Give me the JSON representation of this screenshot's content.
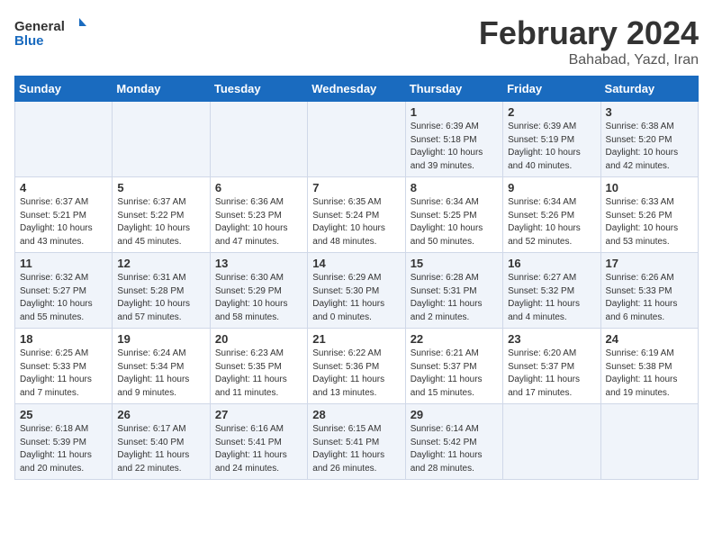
{
  "logo": {
    "line1": "General",
    "line2": "Blue"
  },
  "title": "February 2024",
  "subtitle": "Bahabad, Yazd, Iran",
  "weekdays": [
    "Sunday",
    "Monday",
    "Tuesday",
    "Wednesday",
    "Thursday",
    "Friday",
    "Saturday"
  ],
  "weeks": [
    [
      {
        "day": "",
        "info": ""
      },
      {
        "day": "",
        "info": ""
      },
      {
        "day": "",
        "info": ""
      },
      {
        "day": "",
        "info": ""
      },
      {
        "day": "1",
        "info": "Sunrise: 6:39 AM\nSunset: 5:18 PM\nDaylight: 10 hours\nand 39 minutes."
      },
      {
        "day": "2",
        "info": "Sunrise: 6:39 AM\nSunset: 5:19 PM\nDaylight: 10 hours\nand 40 minutes."
      },
      {
        "day": "3",
        "info": "Sunrise: 6:38 AM\nSunset: 5:20 PM\nDaylight: 10 hours\nand 42 minutes."
      }
    ],
    [
      {
        "day": "4",
        "info": "Sunrise: 6:37 AM\nSunset: 5:21 PM\nDaylight: 10 hours\nand 43 minutes."
      },
      {
        "day": "5",
        "info": "Sunrise: 6:37 AM\nSunset: 5:22 PM\nDaylight: 10 hours\nand 45 minutes."
      },
      {
        "day": "6",
        "info": "Sunrise: 6:36 AM\nSunset: 5:23 PM\nDaylight: 10 hours\nand 47 minutes."
      },
      {
        "day": "7",
        "info": "Sunrise: 6:35 AM\nSunset: 5:24 PM\nDaylight: 10 hours\nand 48 minutes."
      },
      {
        "day": "8",
        "info": "Sunrise: 6:34 AM\nSunset: 5:25 PM\nDaylight: 10 hours\nand 50 minutes."
      },
      {
        "day": "9",
        "info": "Sunrise: 6:34 AM\nSunset: 5:26 PM\nDaylight: 10 hours\nand 52 minutes."
      },
      {
        "day": "10",
        "info": "Sunrise: 6:33 AM\nSunset: 5:26 PM\nDaylight: 10 hours\nand 53 minutes."
      }
    ],
    [
      {
        "day": "11",
        "info": "Sunrise: 6:32 AM\nSunset: 5:27 PM\nDaylight: 10 hours\nand 55 minutes."
      },
      {
        "day": "12",
        "info": "Sunrise: 6:31 AM\nSunset: 5:28 PM\nDaylight: 10 hours\nand 57 minutes."
      },
      {
        "day": "13",
        "info": "Sunrise: 6:30 AM\nSunset: 5:29 PM\nDaylight: 10 hours\nand 58 minutes."
      },
      {
        "day": "14",
        "info": "Sunrise: 6:29 AM\nSunset: 5:30 PM\nDaylight: 11 hours\nand 0 minutes."
      },
      {
        "day": "15",
        "info": "Sunrise: 6:28 AM\nSunset: 5:31 PM\nDaylight: 11 hours\nand 2 minutes."
      },
      {
        "day": "16",
        "info": "Sunrise: 6:27 AM\nSunset: 5:32 PM\nDaylight: 11 hours\nand 4 minutes."
      },
      {
        "day": "17",
        "info": "Sunrise: 6:26 AM\nSunset: 5:33 PM\nDaylight: 11 hours\nand 6 minutes."
      }
    ],
    [
      {
        "day": "18",
        "info": "Sunrise: 6:25 AM\nSunset: 5:33 PM\nDaylight: 11 hours\nand 7 minutes."
      },
      {
        "day": "19",
        "info": "Sunrise: 6:24 AM\nSunset: 5:34 PM\nDaylight: 11 hours\nand 9 minutes."
      },
      {
        "day": "20",
        "info": "Sunrise: 6:23 AM\nSunset: 5:35 PM\nDaylight: 11 hours\nand 11 minutes."
      },
      {
        "day": "21",
        "info": "Sunrise: 6:22 AM\nSunset: 5:36 PM\nDaylight: 11 hours\nand 13 minutes."
      },
      {
        "day": "22",
        "info": "Sunrise: 6:21 AM\nSunset: 5:37 PM\nDaylight: 11 hours\nand 15 minutes."
      },
      {
        "day": "23",
        "info": "Sunrise: 6:20 AM\nSunset: 5:37 PM\nDaylight: 11 hours\nand 17 minutes."
      },
      {
        "day": "24",
        "info": "Sunrise: 6:19 AM\nSunset: 5:38 PM\nDaylight: 11 hours\nand 19 minutes."
      }
    ],
    [
      {
        "day": "25",
        "info": "Sunrise: 6:18 AM\nSunset: 5:39 PM\nDaylight: 11 hours\nand 20 minutes."
      },
      {
        "day": "26",
        "info": "Sunrise: 6:17 AM\nSunset: 5:40 PM\nDaylight: 11 hours\nand 22 minutes."
      },
      {
        "day": "27",
        "info": "Sunrise: 6:16 AM\nSunset: 5:41 PM\nDaylight: 11 hours\nand 24 minutes."
      },
      {
        "day": "28",
        "info": "Sunrise: 6:15 AM\nSunset: 5:41 PM\nDaylight: 11 hours\nand 26 minutes."
      },
      {
        "day": "29",
        "info": "Sunrise: 6:14 AM\nSunset: 5:42 PM\nDaylight: 11 hours\nand 28 minutes."
      },
      {
        "day": "",
        "info": ""
      },
      {
        "day": "",
        "info": ""
      }
    ]
  ]
}
